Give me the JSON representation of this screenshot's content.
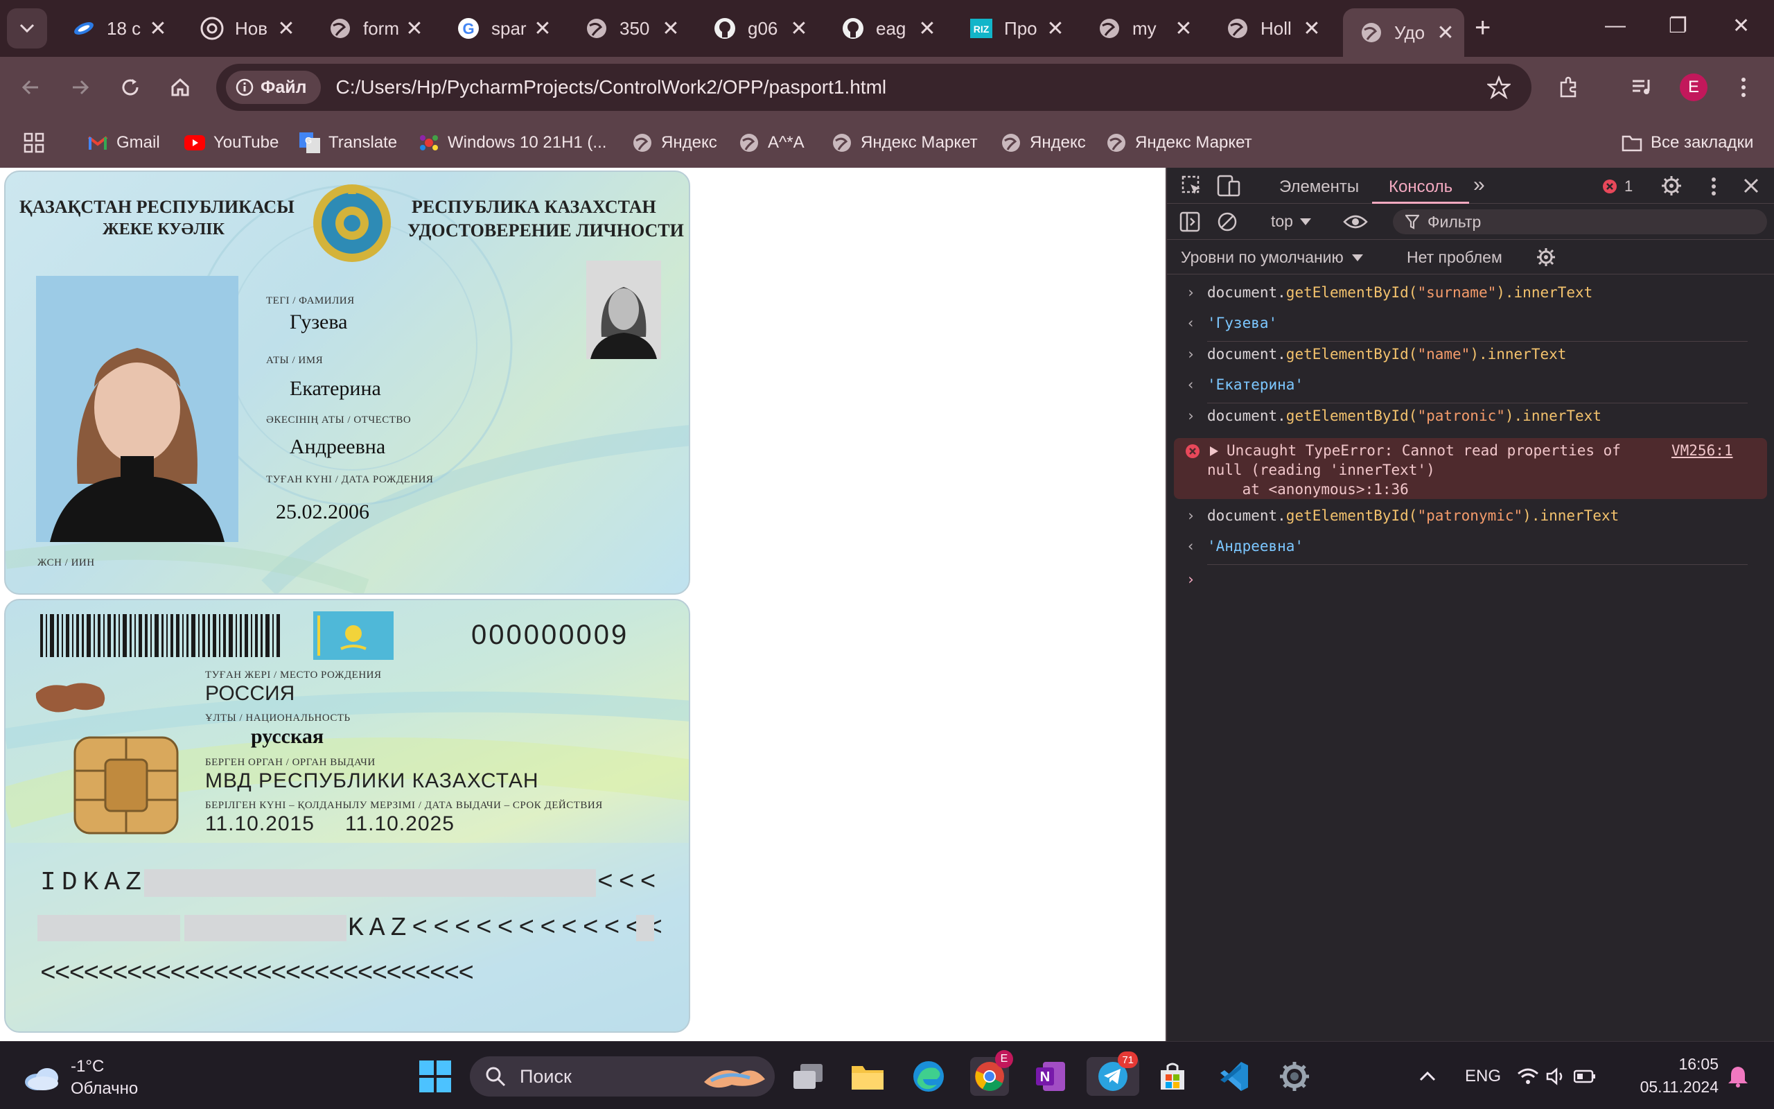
{
  "browser": {
    "tabs": [
      {
        "title": "18 с",
        "icon": "blue-swirl-icon"
      },
      {
        "title": "Нов",
        "icon": "chrome-icon"
      },
      {
        "title": "form",
        "icon": "globe-icon"
      },
      {
        "title": "spar",
        "icon": "google-icon"
      },
      {
        "title": "350",
        "icon": "globe-icon"
      },
      {
        "title": "g06",
        "icon": "github-icon"
      },
      {
        "title": "eag",
        "icon": "github-icon"
      },
      {
        "title": "Про",
        "icon": "riz-icon"
      },
      {
        "title": "my",
        "icon": "globe-icon"
      },
      {
        "title": "Holl",
        "icon": "globe-icon"
      },
      {
        "title": "Удо",
        "icon": "globe-icon",
        "active": true
      }
    ],
    "address": {
      "chip_label": "Файл",
      "url": "C:/Users/Hp/PycharmProjects/ControlWork2/OPP/pasport1.html"
    },
    "profile_letter": "E",
    "bookmarks": [
      {
        "label": "Gmail",
        "icon": "gmail-icon"
      },
      {
        "label": "YouTube",
        "icon": "youtube-icon"
      },
      {
        "label": "Translate",
        "icon": "translate-icon"
      },
      {
        "label": "Windows 10 21H1 (...",
        "icon": "windows-icon"
      },
      {
        "label": "Яндекс",
        "icon": "globe-icon"
      },
      {
        "label": "A^*A",
        "icon": "globe-icon"
      },
      {
        "label": "Яндекс Маркет",
        "icon": "globe-icon"
      },
      {
        "label": "Яндекс",
        "icon": "globe-icon"
      },
      {
        "label": "Яндекс Маркет",
        "icon": "globe-icon"
      }
    ],
    "all_bookmarks": "Все закладки"
  },
  "id_card": {
    "front": {
      "header_kz_1": "ҚАЗАҚСТАН РЕСПУБЛИКАСЫ",
      "header_kz_2": "ЖЕКЕ КУӘЛІК",
      "header_ru_1": "РЕСПУБЛИКА КАЗАХСТАН",
      "header_ru_2": "УДОСТОВЕРЕНИЕ ЛИЧНОСТИ",
      "surname_label": "ТЕГІ / ФАМИЛИЯ",
      "surname": "Гузева",
      "name_label": "АТЫ / ИМЯ",
      "name": "Екатерина",
      "patronymic_label": "ӘКЕСІНІҢ АТЫ / ОТЧЕСТВО",
      "patronymic": "Андреевна",
      "dob_label": "ТУҒАН КҮНІ / ДАТА РОЖДЕНИЯ",
      "dob": "25.02.2006",
      "iin_label": "ЖСН / ИИН"
    },
    "back": {
      "number": "000000009",
      "birthplace_label": "ТУҒАН ЖЕРІ / МЕСТО РОЖДЕНИЯ",
      "birthplace": "РОССИЯ",
      "nationality_label": "ҰЛТЫ / НАЦИОНАЛЬНОСТЬ",
      "nationality": "русская",
      "issuer_label": "БЕРГЕН ОРГАН / ОРГАН ВЫДАЧИ",
      "issuer": "МВД РЕСПУБЛИКИ КАЗАХСТАН",
      "dates_label": "БЕРІЛГЕН КҮНІ – ҚОЛДАНЫЛУ МЕРЗІМІ / ДАТА ВЫДАЧИ – СРОК ДЕЙСТВИЯ",
      "issue_date": "11.10.2015",
      "expiry_date": "11.10.2025",
      "mrz_1_start": "IDKAZ",
      "mrz_1_end": "<<<",
      "mrz_2_mid": "KAZ<<<<<<<<<<<<",
      "mrz_3": "<<<<<<<<<<<<<<<<<<<<<<<<<<<<<<"
    }
  },
  "devtools": {
    "tabs": [
      "Элементы",
      "Консоль"
    ],
    "error_count": "1",
    "context": "top",
    "filter_placeholder": "Фильтр",
    "levels": "Уровни по умолчанию",
    "issues": "Нет проблем",
    "console": [
      {
        "type": "input",
        "obj": "document.",
        "fn": "getElementById(",
        "arg": "\"surname\"",
        "tail": ").innerText"
      },
      {
        "type": "result",
        "value": "'Гузева'"
      },
      {
        "type": "input",
        "obj": "document.",
        "fn": "getElementById(",
        "arg": "\"name\"",
        "tail": ").innerText"
      },
      {
        "type": "result",
        "value": "'Екатерина'"
      },
      {
        "type": "input",
        "obj": "document.",
        "fn": "getElementById(",
        "arg": "\"patronic\"",
        "tail": ").innerText"
      },
      {
        "type": "error",
        "line1": "Uncaught TypeError: Cannot read properties of",
        "line2": "null (reading 'innerText')",
        "line3": "    at <anonymous>:1:36",
        "source": "VM256:1"
      },
      {
        "type": "input",
        "obj": "document.",
        "fn": "getElementById(",
        "arg": "\"patronymic\"",
        "tail": ").innerText"
      },
      {
        "type": "result",
        "value": "'Андреевна'"
      }
    ]
  },
  "taskbar": {
    "weather_temp": "-1°C",
    "weather_desc": "Облачно",
    "search_placeholder": "Поиск",
    "lang": "ENG",
    "time": "16:05",
    "date": "05.11.2024",
    "telegram_badge": "71",
    "chrome_badge": "E"
  }
}
